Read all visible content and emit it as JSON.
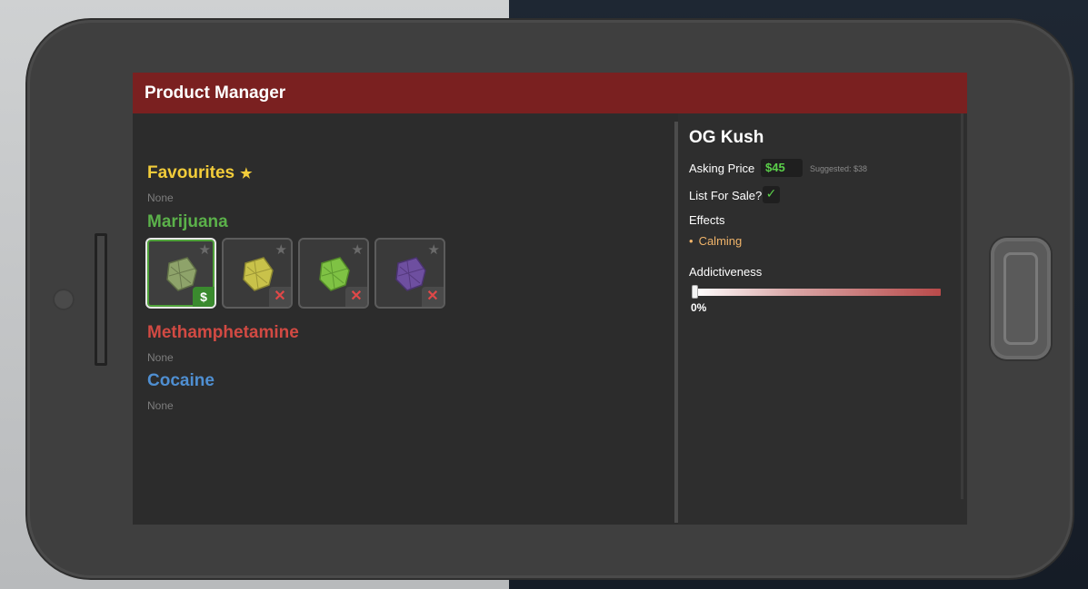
{
  "header": {
    "title": "Product Manager"
  },
  "sections": {
    "favourites": {
      "title": "Favourites",
      "empty_text": "None"
    },
    "marijuana": {
      "title": "Marijuana"
    },
    "methamphetamine": {
      "title": "Methamphetamine",
      "empty_text": "None"
    },
    "cocaine": {
      "title": "Cocaine",
      "empty_text": "None"
    }
  },
  "products": [
    {
      "color": "#8ea36a",
      "listed": true,
      "badge": "$",
      "selected": true
    },
    {
      "color": "#c9c24a",
      "listed": false,
      "badge": "✕",
      "selected": false
    },
    {
      "color": "#7fc244",
      "listed": false,
      "badge": "✕",
      "selected": false
    },
    {
      "color": "#6e4fa0",
      "listed": false,
      "badge": "✕",
      "selected": false
    }
  ],
  "detail": {
    "name": "OG Kush",
    "asking_price_label": "Asking Price",
    "asking_price_value": "$45",
    "suggested": "Suggested: $38",
    "list_for_sale_label": "List For Sale?",
    "list_for_sale_checked": true,
    "effects_label": "Effects",
    "effects": [
      "Calming"
    ],
    "addictiveness_label": "Addictiveness",
    "addictiveness_value": "0%",
    "addictiveness_fraction": 0
  },
  "icons": {
    "favourite": "star-icon",
    "sale": "dollar-icon",
    "not_listed": "x-icon",
    "checked": "check-icon"
  }
}
